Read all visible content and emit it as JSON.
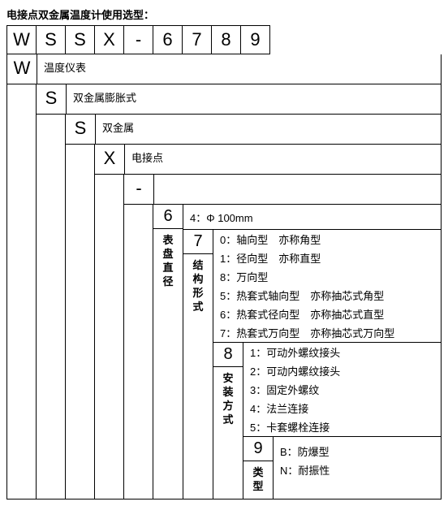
{
  "title": "电接点双金属温度计使用选型：",
  "code": [
    "W",
    "S",
    "S",
    "X",
    "-",
    "6",
    "7",
    "8",
    "9"
  ],
  "levels": [
    {
      "letter": "W",
      "desc": "温度仪表"
    },
    {
      "letter": "S",
      "desc": "双金属膨胀式"
    },
    {
      "letter": "S",
      "desc": "双金属"
    },
    {
      "letter": "X",
      "desc": "电接点"
    },
    {
      "letter": "-",
      "desc": ""
    }
  ],
  "digits": [
    {
      "digit": "6",
      "label": "表盘直径",
      "options": [
        "4：Φ 100mm"
      ]
    },
    {
      "digit": "7",
      "label": "结构形式",
      "options": [
        "0：轴向型　亦称角型",
        "1：径向型　亦称直型",
        "8：万向型",
        "5：热套式轴向型　亦称抽芯式角型",
        "6：热套式径向型　亦称抽芯式直型",
        "7：热套式万向型　亦称抽芯式万向型"
      ]
    },
    {
      "digit": "8",
      "label": "安装方式",
      "options": [
        "1：可动外螺纹接头",
        "2：可动内螺纹接头",
        "3：固定外螺纹",
        "4：法兰连接",
        "5：卡套螺栓连接"
      ]
    },
    {
      "digit": "9",
      "label": "类型",
      "options": [
        "B：防爆型",
        "N：耐振性"
      ]
    }
  ]
}
